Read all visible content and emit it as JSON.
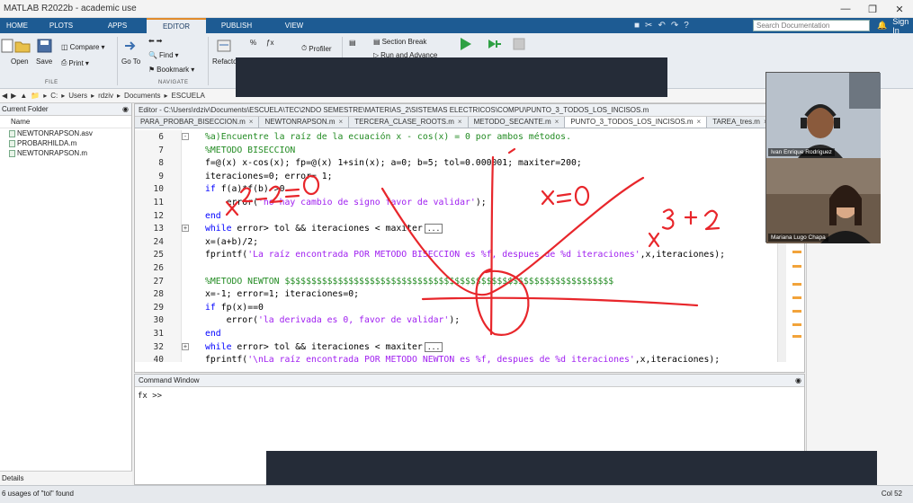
{
  "titlebar": {
    "title": "MATLAB R2022b - academic use"
  },
  "ribbon": {
    "tabs": [
      "HOME",
      "PLOTS",
      "APPS",
      "EDITOR",
      "PUBLISH",
      "VIEW"
    ],
    "active_tab": "EDITOR",
    "search_placeholder": "Search Documentation",
    "sign_in": "Sign In"
  },
  "toolstrip": {
    "file": {
      "open": "Open",
      "save": "Save",
      "group": "FILE"
    },
    "compare": "Compare",
    "print": "Print",
    "go_to": "Go To",
    "find": "Find",
    "bookmark": "Bookmark",
    "navigate_group": "NAVIGATE",
    "refactor": "Refactor",
    "profiler": "Profiler",
    "section_break": "Section Break",
    "run_and_advance": "Run and Advance"
  },
  "address": {
    "segments": [
      "C:",
      "Users",
      "rdziv",
      "Documents",
      "ESCUELA"
    ]
  },
  "folder_panel": {
    "title": "Current Folder",
    "column": "Name",
    "files": [
      "NEWTONRAPSON.asv",
      "PROBARHILDA.m",
      "NEWTONRAPSON.m"
    ],
    "details": "Details"
  },
  "editor": {
    "title": "Editor - C:\\Users\\rdziv\\Documents\\ESCUELA\\TEC\\2NDO SEMESTRE\\MATERIAS_2\\SISTEMAS ELECTRICOS\\COMPU\\PUNTO_3_TODOS_LOS_INCISOS.m",
    "tabs": [
      "PARA_PROBAR_BISECCION.m",
      "NEWTONRAPSON.m",
      "TERCERA_CLASE_ROOTS.m",
      "METODO_SECANTE.m",
      "PUNTO_3_TODOS_LOS_INCISOS.m",
      "TAREA_tres.m"
    ],
    "active_tab": "PUNTO_3_TODOS_LOS_INCISOS.m",
    "lines": [
      {
        "num": "6",
        "fold": "-",
        "segments": [
          {
            "cls": "cm",
            "text": "%a)Encuentre la raíz de la ecuación x - cos(x) = 0 por ambos métodos."
          }
        ]
      },
      {
        "num": "7",
        "segments": [
          {
            "cls": "cm",
            "text": "%METODO BISECCION"
          }
        ]
      },
      {
        "num": "8",
        "segments": [
          {
            "cls": "",
            "text": "f=@(x) x-cos(x); fp=@(x) 1+sin(x); a=0; b=5; tol=0.000001; maxiter=200;"
          }
        ]
      },
      {
        "num": "9",
        "segments": [
          {
            "cls": "",
            "text": "iteraciones=0; error= 1;"
          }
        ]
      },
      {
        "num": "10",
        "segments": [
          {
            "cls": "kw",
            "text": "if "
          },
          {
            "cls": "",
            "text": "f(a)*f(b) >0"
          }
        ]
      },
      {
        "num": "11",
        "segments": [
          {
            "cls": "",
            "text": "    error("
          },
          {
            "cls": "st",
            "text": "'no hay cambio de signo favor de validar'"
          },
          {
            "cls": "",
            "text": ");"
          }
        ]
      },
      {
        "num": "12",
        "segments": [
          {
            "cls": "kw",
            "text": "end"
          }
        ]
      },
      {
        "num": "13",
        "fold": "+",
        "ellipsis": "...",
        "segments": [
          {
            "cls": "kw",
            "text": "while "
          },
          {
            "cls": "",
            "text": "error> tol && iteraciones < maxiter"
          }
        ]
      },
      {
        "num": "24",
        "segments": [
          {
            "cls": "",
            "text": "x=(a+b)/2;"
          }
        ]
      },
      {
        "num": "25",
        "segments": [
          {
            "cls": "",
            "text": "fprintf("
          },
          {
            "cls": "st",
            "text": "'La raíz encontrada POR METODO BISECCION es %f, despues de %d iteraciones'"
          },
          {
            "cls": "",
            "text": ",x,iteraciones);"
          }
        ]
      },
      {
        "num": "26",
        "segments": [
          {
            "cls": "",
            "text": ""
          }
        ]
      },
      {
        "num": "27",
        "segments": [
          {
            "cls": "cm",
            "text": "%METODO NEWTON $$$$$$$$$$$$$$$$$$$$$$$$$$$$$$$$$$$$$$$$$$$$$$$$$$$$$$$$$$$$$$"
          }
        ]
      },
      {
        "num": "28",
        "segments": [
          {
            "cls": "",
            "text": "x=-1; error=1; iteraciones=0;"
          }
        ]
      },
      {
        "num": "29",
        "segments": [
          {
            "cls": "kw",
            "text": "if "
          },
          {
            "cls": "",
            "text": "fp(x)==0"
          }
        ]
      },
      {
        "num": "30",
        "segments": [
          {
            "cls": "",
            "text": "    error("
          },
          {
            "cls": "st",
            "text": "'la derivada es 0, favor de validar'"
          },
          {
            "cls": "",
            "text": ");"
          }
        ]
      },
      {
        "num": "31",
        "segments": [
          {
            "cls": "kw",
            "text": "end"
          }
        ]
      },
      {
        "num": "32",
        "fold": "+",
        "ellipsis": "...",
        "segments": [
          {
            "cls": "kw",
            "text": "while "
          },
          {
            "cls": "",
            "text": "error> tol && iteraciones < maxiter"
          }
        ]
      },
      {
        "num": "40",
        "segments": [
          {
            "cls": "",
            "text": "fprintf("
          },
          {
            "cls": "st",
            "text": "'\\nLa raíz encontrada POR METODO NEWTON es %f, despues de %d iteraciones'"
          },
          {
            "cls": "",
            "text": ",x,iteraciones);"
          }
        ]
      }
    ]
  },
  "command_window": {
    "title": "Command Window",
    "fx": "fx",
    "prompt": ">>"
  },
  "status": {
    "left": "6 usages of \"tol\" found",
    "right": "Col 52"
  },
  "video": {
    "participants": [
      "Ivan Enrique Rodriguez",
      "Mariana Lugo Chapa"
    ]
  },
  "annotations": [
    "x-2=0",
    "x=0",
    "x^3+2"
  ],
  "colors": {
    "ribbon": "#1d5b93",
    "ink": "#e8262b",
    "comment": "#228b22",
    "keyword": "#0000ff",
    "string": "#a020f0"
  }
}
